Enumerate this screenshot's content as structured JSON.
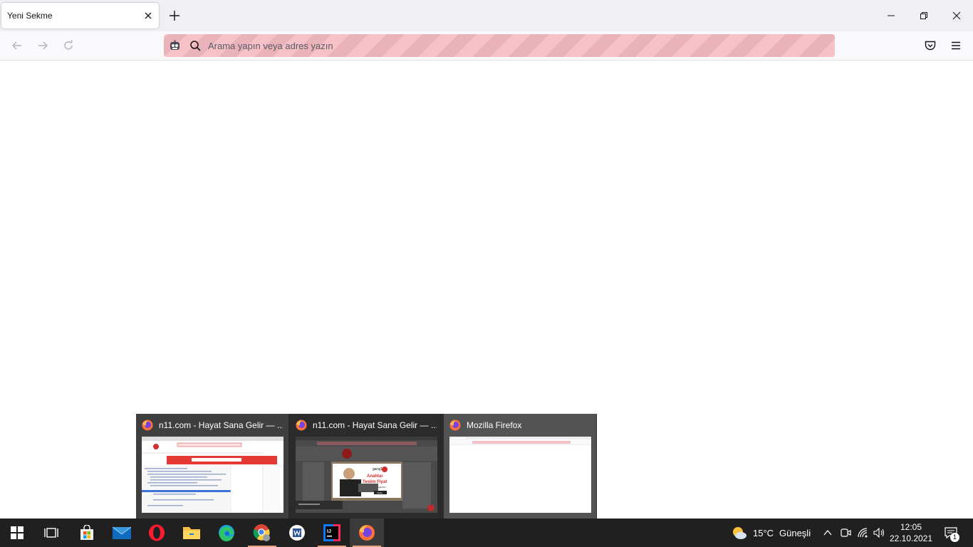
{
  "tab": {
    "title": "Yeni Sekme"
  },
  "urlbar": {
    "placeholder": "Arama yapın veya adres yazın"
  },
  "thumbnails": [
    {
      "title": "n11.com - Hayat Sana Gelir — ..."
    },
    {
      "title": "n11.com - Hayat Sana Gelir — ...",
      "ad": {
        "brand": "garaj11",
        "line1": "Anahtar",
        "line2": "Teslim Fiyat",
        "line3": "garaj11'de!",
        "button": "İncele"
      }
    },
    {
      "title": "Mozilla Firefox"
    }
  ],
  "taskbar": {
    "apps": [
      "start-button",
      "task-view",
      "microsoft-store",
      "mail",
      "opera",
      "file-explorer",
      "edge",
      "chrome",
      "word",
      "intellij",
      "firefox"
    ],
    "weather": {
      "temp": "15°C",
      "condition": "Güneşli"
    },
    "clock": {
      "time": "12:05",
      "date": "22.10.2021"
    },
    "notifications": "1"
  },
  "colors": {
    "urlbar_stripe_a": "#f6c2c7",
    "urlbar_stripe_b": "#e9b3b9",
    "taskbar": "#202020",
    "accent": "#e5a27a"
  }
}
